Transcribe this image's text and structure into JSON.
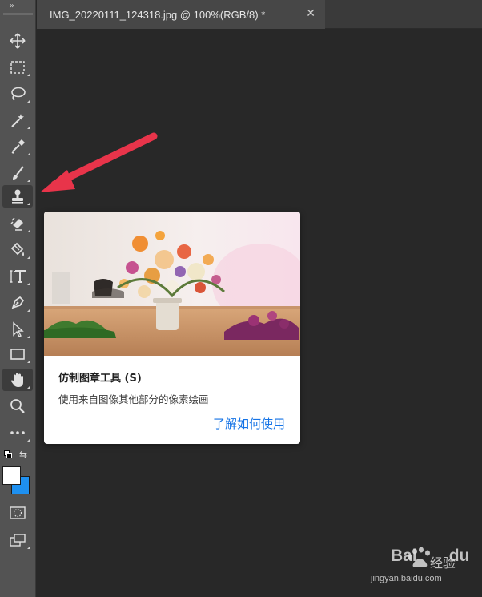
{
  "document_tab": {
    "title": "IMG_20220111_124318.jpg @ 100%(RGB/8) *",
    "close_icon": "close-icon"
  },
  "toolbar": {
    "collapse_label": "»",
    "tools": [
      {
        "name": "move-tool",
        "icon": "move-icon",
        "has_submenu": false
      },
      {
        "name": "rectangular-marquee-tool",
        "icon": "marquee-icon",
        "has_submenu": true
      },
      {
        "name": "lasso-tool",
        "icon": "lasso-icon",
        "has_submenu": true
      },
      {
        "name": "magic-wand-tool",
        "icon": "magic-wand-icon",
        "has_submenu": true
      },
      {
        "name": "eyedropper-tool",
        "icon": "eyedropper-icon",
        "has_submenu": true
      },
      {
        "name": "brush-tool",
        "icon": "brush-icon",
        "has_submenu": true
      },
      {
        "name": "clone-stamp-tool",
        "icon": "stamp-icon",
        "has_submenu": true,
        "active": true
      },
      {
        "name": "eraser-tool",
        "icon": "eraser-icon",
        "has_submenu": true
      },
      {
        "name": "paint-bucket-tool",
        "icon": "paint-bucket-icon",
        "has_submenu": true
      },
      {
        "name": "type-tool",
        "icon": "type-icon",
        "has_submenu": true
      },
      {
        "name": "pen-tool",
        "icon": "pen-icon",
        "has_submenu": true
      },
      {
        "name": "path-selection-tool",
        "icon": "selection-arrow-icon",
        "has_submenu": true
      },
      {
        "name": "rectangle-tool",
        "icon": "rectangle-icon",
        "has_submenu": true
      },
      {
        "name": "hand-tool",
        "icon": "hand-icon",
        "has_submenu": true,
        "highlighted": true
      },
      {
        "name": "zoom-tool",
        "icon": "zoom-icon",
        "has_submenu": false
      },
      {
        "name": "more-tools",
        "icon": "more-icon",
        "has_submenu": true
      }
    ],
    "foreground_color": "#ffffff",
    "background_color": "#1e90f0",
    "swap_label": "⇆",
    "quick_mask_icon": "quick-mask-icon",
    "screen_mode_icon": "screen-mode-icon"
  },
  "tooltip": {
    "title": "仿制图章工具 (S)",
    "description": "使用来自图像其他部分的像素绘画",
    "link": "了解如何使用",
    "image": "flower-arrangement-image"
  },
  "annotation": {
    "arrow_color": "#e8344a"
  },
  "watermark": {
    "brand": "Bai",
    "brand_suffix": "du",
    "product": "经验",
    "url": "jingyan.baidu.com"
  },
  "colors": {
    "workspace": "#282828",
    "toolbar": "#535353",
    "tab_active": "#474747",
    "link": "#1473e6"
  }
}
